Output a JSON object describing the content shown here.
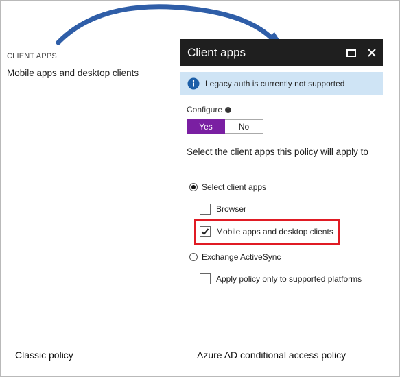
{
  "classic": {
    "header": "CLIENT APPS",
    "value": "Mobile apps and desktop clients",
    "caption": "Classic policy"
  },
  "azure": {
    "caption": "Azure AD conditional access policy"
  },
  "blade": {
    "title": "Client apps",
    "info_text": "Legacy auth is currently not supported",
    "configure_label": "Configure",
    "toggle": {
      "yes": "Yes",
      "no": "No",
      "selected": "Yes"
    },
    "description": "Select the client apps this policy will apply to",
    "options": {
      "select_client_apps": "Select client apps",
      "browser": "Browser",
      "mobile_desktop": "Mobile apps and desktop clients",
      "exchange": "Exchange ActiveSync",
      "supported_platforms": "Apply policy only to supported platforms"
    }
  },
  "colors": {
    "header_bg": "#1f1f1f",
    "info_bg": "#cfe4f5",
    "toggle_accent": "#7a1fa2",
    "highlight": "#e01b24",
    "arrow": "#2f5ea8"
  },
  "icons": {
    "maximize": "maximize-icon",
    "close": "close-icon",
    "info": "info-icon",
    "check": "checkmark-icon",
    "arrow": "curved-arrow-icon"
  }
}
